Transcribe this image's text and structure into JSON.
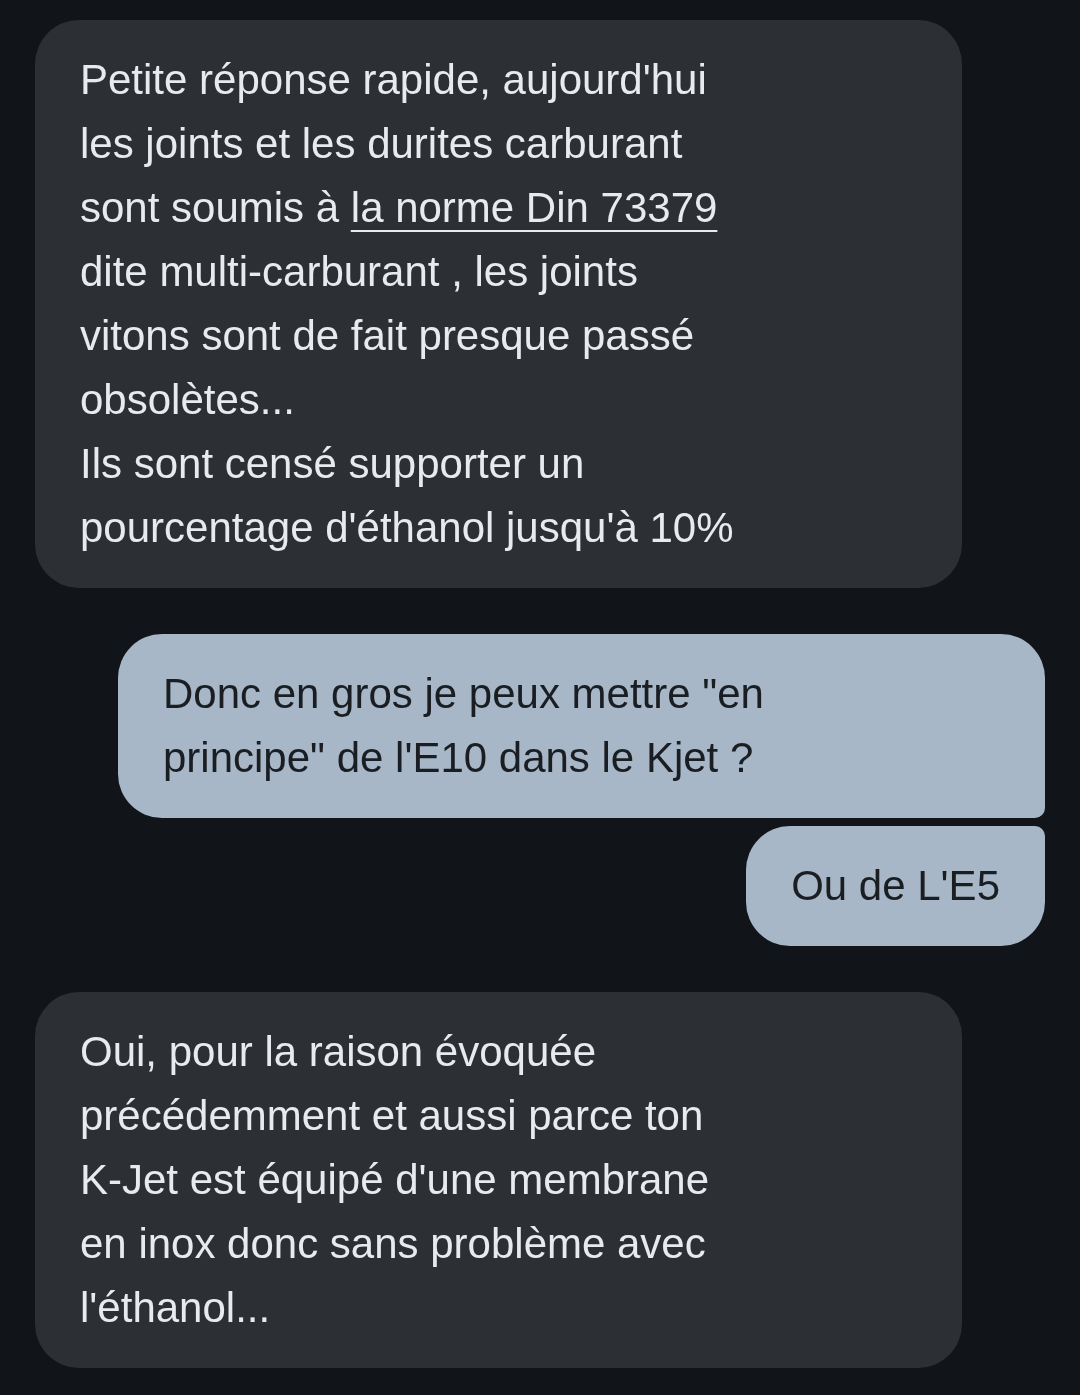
{
  "messages": [
    {
      "kind": "incoming",
      "parts": [
        {
          "kind": "text",
          "text": "Petite réponse rapide, aujourd'hui\nles joints et les durites carburant\nsont soumis à "
        },
        {
          "kind": "link",
          "text": "la norme Din 73379"
        },
        {
          "kind": "text",
          "text": "\ndite multi-carburant , les joints\nvitons sont de fait presque passé\nobsolètes...\nIls sont censé supporter un\npourcentage d'éthanol jusqu'à 10%"
        }
      ]
    },
    {
      "kind": "outgoing",
      "parts": [
        {
          "kind": "text",
          "text": "Donc en gros je peux mettre \"en\nprincipe\" de l'E10 dans le Kjet ?"
        }
      ]
    },
    {
      "kind": "outgoing",
      "parts": [
        {
          "kind": "text",
          "text": "Ou de L'E5"
        }
      ]
    },
    {
      "kind": "incoming",
      "parts": [
        {
          "kind": "text",
          "text": "Oui, pour la raison évoquée\nprécédemment et aussi parce ton\nK-Jet est équipé d'une membrane\nen inox donc sans problème avec\nl'éthanol..."
        }
      ]
    }
  ]
}
